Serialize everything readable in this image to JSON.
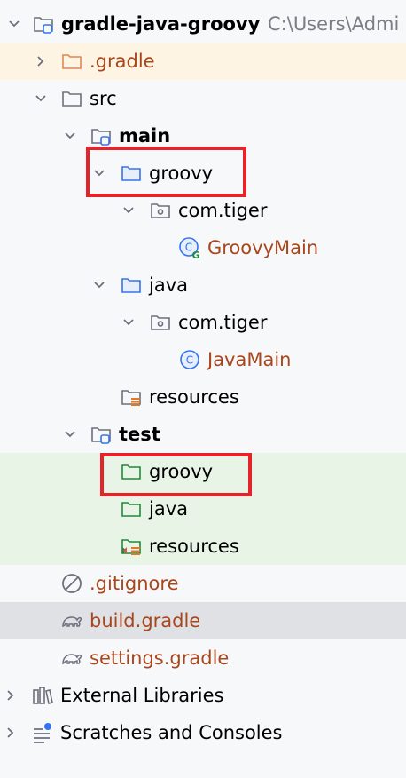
{
  "project": {
    "name": "gradle-java-groovy",
    "path": "C:\\Users\\Admi"
  },
  "tree": {
    "gradle_dir": ".gradle",
    "src": "src",
    "main": "main",
    "main_groovy": "groovy",
    "main_groovy_pkg": "com.tiger",
    "groovy_main": "GroovyMain",
    "main_java": "java",
    "main_java_pkg": "com.tiger",
    "java_main": "JavaMain",
    "main_resources": "resources",
    "test": "test",
    "test_groovy": "groovy",
    "test_java": "java",
    "test_resources": "resources",
    "gitignore": ".gitignore",
    "build_gradle": "build.gradle",
    "settings_gradle": "settings.gradle",
    "external_libraries": "External Libraries",
    "scratches": "Scratches and Consoles"
  },
  "colors": {
    "folder": "#6c707e",
    "source_folder": "#3574f0",
    "test_folder": "#208a3c",
    "file_brown": "#a8461c",
    "highlight_box": "#e3242b"
  },
  "icons": {
    "project": "module-folder-icon",
    "class": "class-icon",
    "groovy_class": "groovy-class-icon",
    "gradle": "gradle-elephant-icon",
    "ignore": "ignore-file-icon",
    "libraries": "libraries-icon",
    "scratches": "scratches-icon"
  }
}
